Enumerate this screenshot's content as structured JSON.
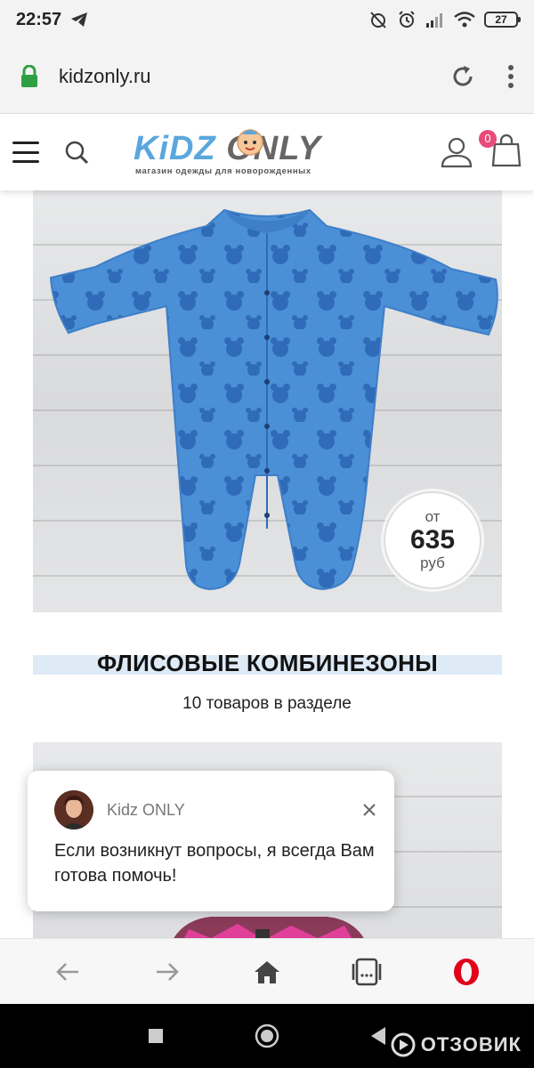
{
  "status_bar": {
    "time": "22:57",
    "battery": "27"
  },
  "browser": {
    "url": "kidzonly.ru"
  },
  "site": {
    "logo_kidz": "KiDZ",
    "logo_only": "ONLY",
    "logo_tagline": "магазин одежды для новорожденных",
    "cart_count": "0"
  },
  "category": {
    "price_from": "от",
    "price_value": "635",
    "price_unit": "руб",
    "title": "ФЛИСОВЫЕ КОМБИНЕЗОНЫ",
    "count_text": "10 товаров в разделе"
  },
  "chat": {
    "name": "Kidz ONLY",
    "message": "Если возникнут вопросы, я всегда Вам готова помочь!"
  },
  "watermark": {
    "text": "ОТЗОВИК"
  },
  "colors": {
    "accent_pink": "#e84a7a",
    "logo_blue": "#5aa7dd",
    "fleece_blue": "#4b8fd6",
    "title_highlight": "#deeaf5"
  }
}
